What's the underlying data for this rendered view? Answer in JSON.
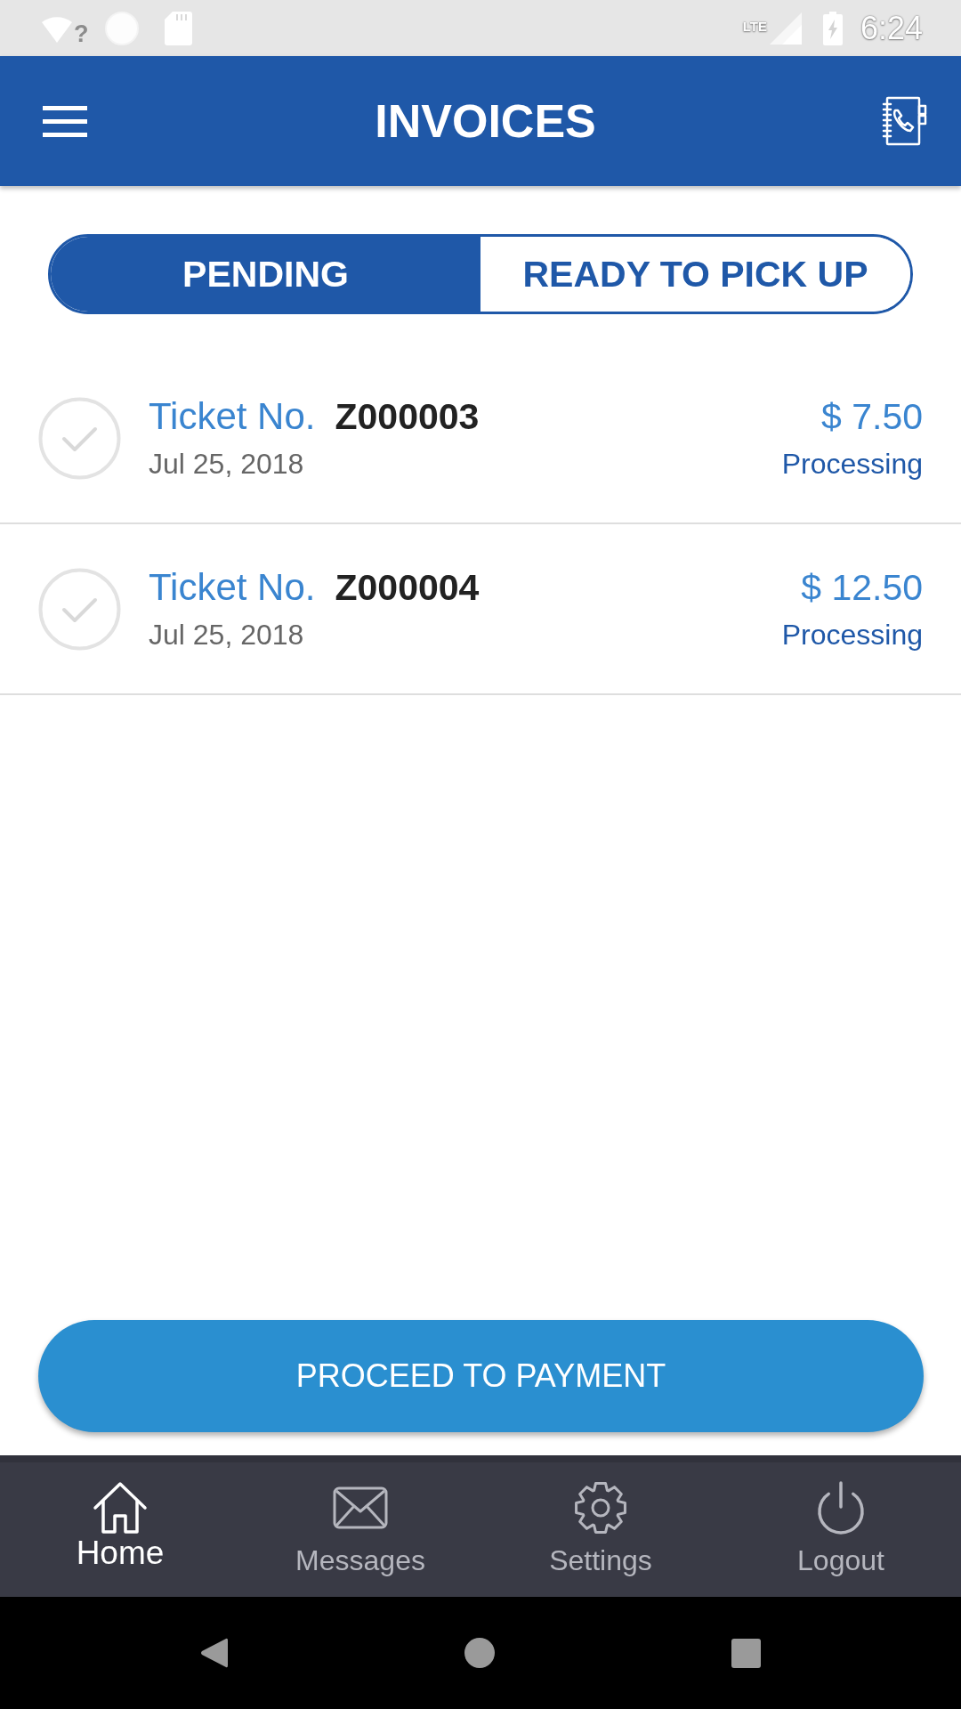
{
  "status_bar": {
    "wifi_badge": "?",
    "network": "LTE",
    "time": "6:24"
  },
  "header": {
    "title": "INVOICES"
  },
  "tabs": [
    {
      "label": "PENDING",
      "selected": true
    },
    {
      "label": "READY TO PICK UP",
      "selected": false
    }
  ],
  "invoices": [
    {
      "ticket_label": "Ticket No.",
      "ticket_number": "Z000003",
      "date": "Jul 25, 2018",
      "amount": "$ 7.50",
      "status": "Processing",
      "checked": false
    },
    {
      "ticket_label": "Ticket No.",
      "ticket_number": "Z000004",
      "date": "Jul 25, 2018",
      "amount": "$ 12.50",
      "status": "Processing",
      "checked": false
    }
  ],
  "payment_button": {
    "label": "PROCEED TO PAYMENT"
  },
  "bottom_nav": [
    {
      "kind": "home",
      "label": "Home",
      "selected": true
    },
    {
      "kind": "mail",
      "label": "Messages",
      "selected": false
    },
    {
      "kind": "gear",
      "label": "Settings",
      "selected": false
    },
    {
      "kind": "power",
      "label": "Logout",
      "selected": false
    }
  ]
}
